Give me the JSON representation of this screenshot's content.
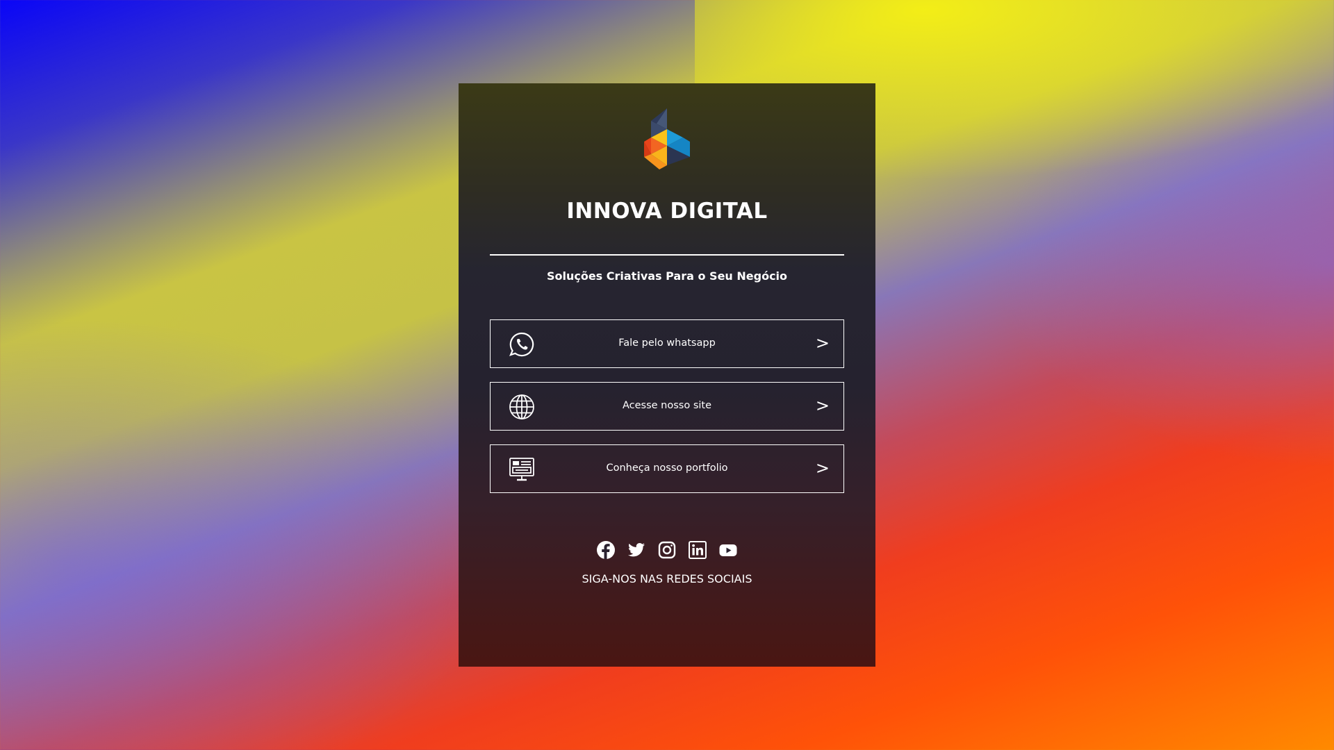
{
  "brand": {
    "name": "INNOVA DIGITAL",
    "tagline": "Soluções Criativas Para o Seu Negócio"
  },
  "links": [
    {
      "label": "Fale pelo whatsapp",
      "icon": "whatsapp-icon",
      "arrow": ">"
    },
    {
      "label": "Acesse nosso site",
      "icon": "globe-icon",
      "arrow": ">"
    },
    {
      "label": "Conheça nosso portfolio",
      "icon": "portfolio-monitor-icon",
      "arrow": ">"
    }
  ],
  "socials": {
    "icons": [
      "facebook-icon",
      "twitter-icon",
      "instagram-icon",
      "linkedin-icon",
      "youtube-icon"
    ],
    "caption": "SIGA-NOS NAS REDES SOCIAIS"
  },
  "colors": {
    "text": "#ffffff",
    "logo_blue": "#1e9bd7",
    "logo_orange": "#f7941d",
    "logo_red": "#e8441b",
    "logo_yellow": "#f9c31b",
    "logo_slate": "#3b4a6b"
  }
}
